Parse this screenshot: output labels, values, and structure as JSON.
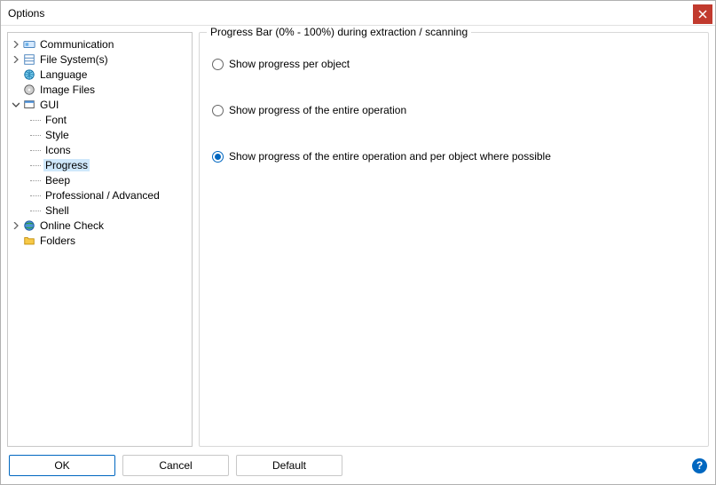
{
  "window": {
    "title": "Options"
  },
  "tree": {
    "communication": "Communication",
    "filesystem": "File System(s)",
    "language": "Language",
    "imagefiles": "Image Files",
    "gui": "GUI",
    "gui_children": {
      "font": "Font",
      "style": "Style",
      "icons": "Icons",
      "progress": "Progress",
      "beep": "Beep",
      "professional": "Professional / Advanced",
      "shell": "Shell"
    },
    "onlinecheck": "Online Check",
    "folders": "Folders"
  },
  "group": {
    "title": "Progress Bar (0% - 100%) during extraction / scanning",
    "opt1": "Show progress per object",
    "opt2": "Show progress of the entire operation",
    "opt3": "Show progress of the entire operation and per object where possible"
  },
  "buttons": {
    "ok": "OK",
    "cancel": "Cancel",
    "default": "Default"
  }
}
